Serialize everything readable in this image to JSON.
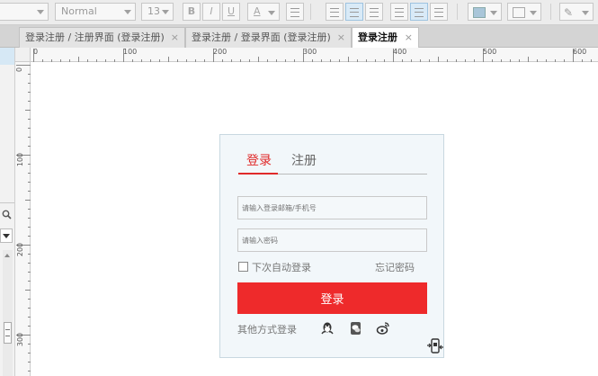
{
  "toolbar": {
    "font_style": "Normal",
    "font_size": "13",
    "bold": "B",
    "italic": "I",
    "underline": "U",
    "font_color": "A"
  },
  "tabs": [
    {
      "label": "登录注册 / 注册界面 (登录注册)",
      "close": "×"
    },
    {
      "label": "登录注册 / 登录界面 (登录注册)",
      "close": "×"
    },
    {
      "label": "登录注册",
      "close": "×"
    }
  ],
  "ruler": {
    "h_labels": [
      "0",
      "100",
      "200",
      "300",
      "400",
      "500",
      "600"
    ],
    "v_labels": [
      "0",
      "100",
      "200",
      "300"
    ]
  },
  "login": {
    "tab_login": "登录",
    "tab_register": "注册",
    "email_placeholder": "请输入登录邮箱/手机号",
    "password_placeholder": "请输入密码",
    "remember_label": "下次自动登录",
    "forgot_label": "忘记密码",
    "submit_label": "登录",
    "other_methods_label": "其他方式登录",
    "accent_color": "#ee2a2b"
  },
  "icons": {
    "social": [
      "qq-icon",
      "wechat-icon",
      "weibo-icon"
    ],
    "mobile": "mobile-qr-icon"
  }
}
